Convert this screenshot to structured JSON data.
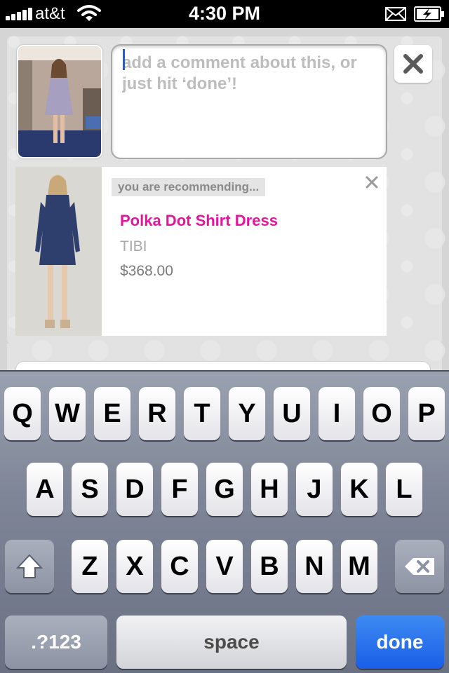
{
  "status_bar": {
    "carrier": "at&t",
    "time": "4:30 PM"
  },
  "comment": {
    "placeholder": "add a comment about this, or just hit ‘done’!",
    "value": ""
  },
  "recommendation": {
    "badge": "you are recommending...",
    "product_name": "Polka Dot Shirt Dress",
    "brand": "TIBI",
    "price": "$368.00"
  },
  "keyboard": {
    "row1": [
      "Q",
      "W",
      "E",
      "R",
      "T",
      "Y",
      "U",
      "I",
      "O",
      "P"
    ],
    "row2": [
      "A",
      "S",
      "D",
      "F",
      "G",
      "H",
      "J",
      "K",
      "L"
    ],
    "row3": [
      "Z",
      "X",
      "C",
      "V",
      "B",
      "N",
      "M"
    ],
    "numbers_label": ".?123",
    "space_label": "space",
    "done_label": "done"
  },
  "colors": {
    "accent_pink": "#e5149b",
    "done_blue": "#1a5ee8"
  }
}
